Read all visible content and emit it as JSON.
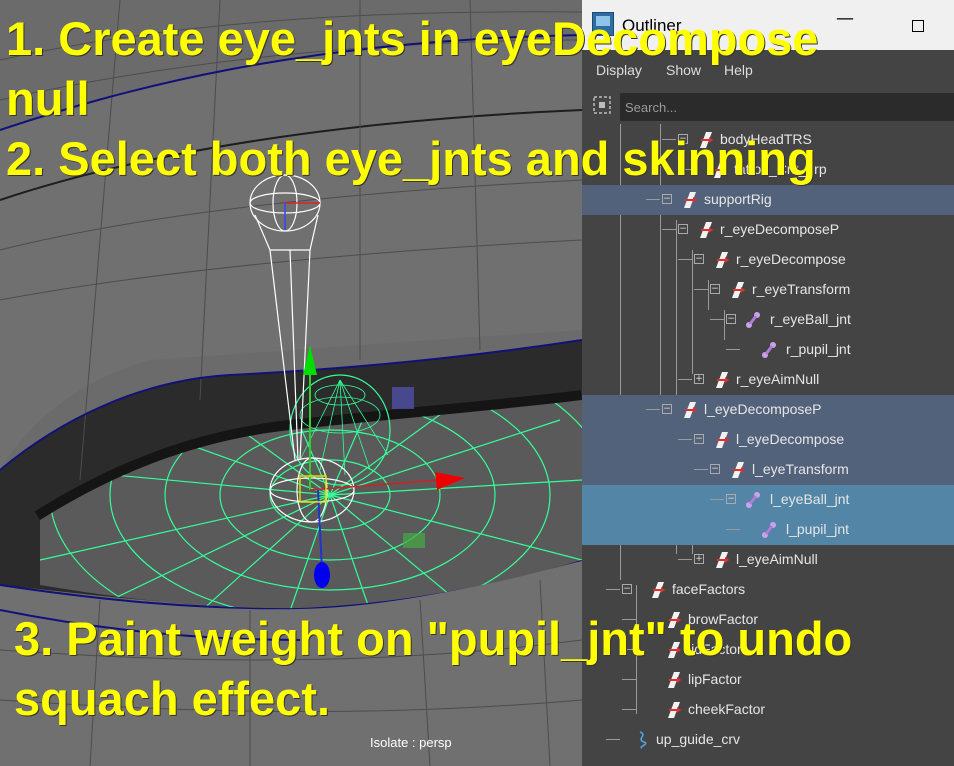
{
  "viewport": {
    "camera_label": "Isolate : persp"
  },
  "outliner": {
    "title": "Outliner",
    "menu": [
      "Display",
      "Show",
      "Help"
    ],
    "search_placeholder": "Search...",
    "items": [
      {
        "label": "bodyHeadTRS",
        "icon": "transform-icon",
        "state": "normal",
        "expander": "minus"
      },
      {
        "label": "tattoo_Cnt_grp",
        "icon": "transform-icon",
        "state": "normal",
        "expander": "none"
      },
      {
        "label": "supportRig",
        "icon": "transform-icon",
        "state": "highlight",
        "expander": "minus"
      },
      {
        "label": "r_eyeDecomposeP",
        "icon": "transform-icon",
        "state": "normal",
        "expander": "minus"
      },
      {
        "label": "r_eyeDecompose",
        "icon": "transform-icon",
        "state": "normal",
        "expander": "minus"
      },
      {
        "label": "r_eyeTransform",
        "icon": "transform-icon",
        "state": "normal",
        "expander": "minus"
      },
      {
        "label": "r_eyeBall_jnt",
        "icon": "joint-icon",
        "state": "normal",
        "expander": "minus"
      },
      {
        "label": "r_pupil_jnt",
        "icon": "joint-icon",
        "state": "normal",
        "expander": "none"
      },
      {
        "label": "r_eyeAimNull",
        "icon": "transform-icon",
        "state": "normal",
        "expander": "plus"
      },
      {
        "label": "l_eyeDecomposeP",
        "icon": "transform-icon",
        "state": "highlight",
        "expander": "minus"
      },
      {
        "label": "l_eyeDecompose",
        "icon": "transform-icon",
        "state": "highlight",
        "expander": "minus"
      },
      {
        "label": "l_eyeTransform",
        "icon": "transform-icon",
        "state": "highlight",
        "expander": "minus"
      },
      {
        "label": "l_eyeBall_jnt",
        "icon": "joint-icon",
        "state": "selected",
        "expander": "minus"
      },
      {
        "label": "l_pupil_jnt",
        "icon": "joint-icon",
        "state": "selected",
        "expander": "none"
      },
      {
        "label": "l_eyeAimNull",
        "icon": "transform-icon",
        "state": "normal",
        "expander": "plus"
      },
      {
        "label": "faceFactors",
        "icon": "transform-icon",
        "state": "normal",
        "expander": "minus"
      },
      {
        "label": "browFactor",
        "icon": "transform-icon",
        "state": "normal",
        "expander": "none"
      },
      {
        "label": "lidFactor",
        "icon": "transform-icon",
        "state": "normal",
        "expander": "none"
      },
      {
        "label": "lipFactor",
        "icon": "transform-icon",
        "state": "normal",
        "expander": "none"
      },
      {
        "label": "cheekFactor",
        "icon": "transform-icon",
        "state": "normal",
        "expander": "none"
      },
      {
        "label": "up_guide_crv",
        "icon": "curve-icon",
        "state": "normal",
        "expander": "none"
      }
    ]
  },
  "annotations": {
    "line1": "1. Create eye_jnts in eyeDecompose",
    "line2": "null",
    "line3": "2. Select both eye_jnts and skinning",
    "line4": "3. Paint weight on \"pupil_jnt\" to undo",
    "line5": "squach effect."
  },
  "colors": {
    "annotation": "#ffff00",
    "selection": "#5285a6",
    "highlight": "#53627b",
    "panel_bg": "#444444",
    "wireframe_green": "#33ff99"
  }
}
